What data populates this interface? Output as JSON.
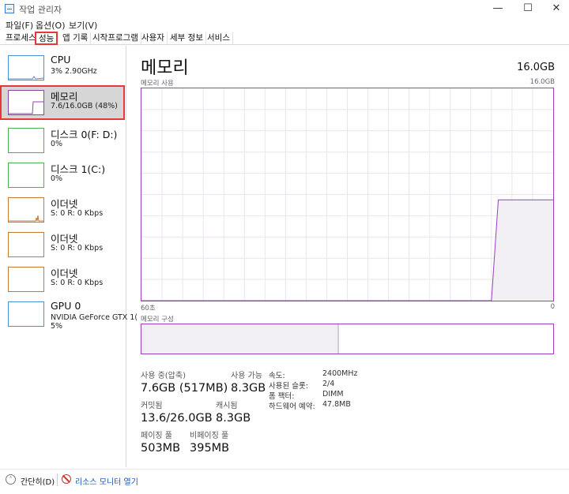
{
  "window": {
    "title": "작업 관리자",
    "minimize": "—",
    "maximize": "☐",
    "close": "✕"
  },
  "menu": {
    "file": "파일(F)",
    "options": "옵션(O)",
    "view": "보기(V)"
  },
  "tabs": [
    {
      "label": "프로세스"
    },
    {
      "label": "성능"
    },
    {
      "label": "앱 기록"
    },
    {
      "label": "시작프로그램"
    },
    {
      "label": "사용자"
    },
    {
      "label": "세부 정보"
    },
    {
      "label": "서비스"
    }
  ],
  "resources": [
    {
      "name": "CPU",
      "sub": "3% 2.90GHz",
      "sub2": "",
      "color": "#4a90d9"
    },
    {
      "name": "메모리",
      "sub": "7.6/16.0GB (48%)",
      "sub2": "",
      "color": "#8e44ad"
    },
    {
      "name": "디스크 0(F: D:)",
      "sub": "0%",
      "sub2": "",
      "color": "#4caf50"
    },
    {
      "name": "디스크 1(C:)",
      "sub": "0%",
      "sub2": "",
      "color": "#4caf50"
    },
    {
      "name": "이더넷",
      "sub": "S: 0 R: 0 Kbps",
      "sub2": "",
      "color": "#c97a2b"
    },
    {
      "name": "이더넷",
      "sub": "S: 0 R: 0 Kbps",
      "sub2": "",
      "color": "#c97a2b"
    },
    {
      "name": "이더넷",
      "sub": "S: 0 R: 0 Kbps",
      "sub2": "",
      "color": "#c97a2b"
    },
    {
      "name": "GPU 0",
      "sub": "NVIDIA GeForce GTX 1(",
      "sub2": "5%",
      "color": "#4a90d9"
    }
  ],
  "main": {
    "title": "메모리",
    "total": "16.0GB",
    "usage_label": "메모리 사용",
    "usage_max": "16.0GB",
    "time_left": "60초",
    "time_right": "0",
    "composition_label": "메모리 구성",
    "usage_series": {
      "x": [
        60,
        9,
        8,
        0
      ],
      "y": [
        0,
        0,
        7.6,
        7.6
      ],
      "ymax": 16
    },
    "composition_used_fraction": 0.48
  },
  "stats": {
    "in_use_label": "사용 중(압축)",
    "in_use_value": "7.6GB (517MB)",
    "available_label": "사용 가능",
    "available_value": "8.3GB",
    "committed_label": "커밋됨",
    "committed_value": "13.6/26.0GB",
    "cached_label": "캐시됨",
    "cached_value": "8.3GB",
    "paged_label": "페이징 풀",
    "paged_value": "503MB",
    "nonpaged_label": "비페이징 풀",
    "nonpaged_value": "395MB",
    "speed_label": "속도:",
    "speed_value": "2400MHz",
    "slots_label": "사용된 슬롯:",
    "slots_value": "2/4",
    "form_label": "폼 팩터:",
    "form_value": "DIMM",
    "reserved_label": "하드웨어 예약:",
    "reserved_value": "47.8MB"
  },
  "footer": {
    "fewer_details": "간단히(D)",
    "resource_monitor": "리소스 모니터 열기"
  }
}
